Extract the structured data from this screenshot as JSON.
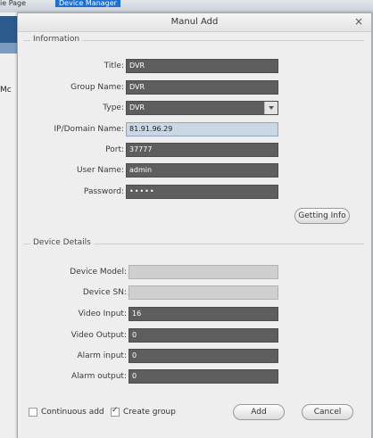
{
  "background": {
    "tab_text": "ie Page",
    "tab_active": "Device Manager",
    "side_label": "Mc"
  },
  "dialog": {
    "title": "Manul Add",
    "close_glyph": "×"
  },
  "information": {
    "section_label": "Information",
    "title_label": "Title:",
    "title_value": "DVR",
    "group_label": "Group Name:",
    "group_value": "DVR",
    "type_label": "Type:",
    "type_value": "DVR",
    "ip_label": "IP/Domain Name:",
    "ip_value": "81.91.96.29",
    "port_label": "Port:",
    "port_value": "37777",
    "user_label": "User Name:",
    "user_value": "admin",
    "password_label": "Password:",
    "password_value": "•••••",
    "getting_info_label": "Getting Info"
  },
  "device_details": {
    "section_label": "Device Details",
    "model_label": "Device Model:",
    "model_value": "",
    "sn_label": "Device SN:",
    "sn_value": "",
    "video_input_label": "Video Input:",
    "video_input_value": "16",
    "video_output_label": "Video Output:",
    "video_output_value": "0",
    "alarm_input_label": "Alarm input:",
    "alarm_input_value": "0",
    "alarm_output_label": "Alarm output:",
    "alarm_output_value": "0"
  },
  "footer": {
    "continuous_add_label": "Continuous add",
    "continuous_add_checked": false,
    "create_group_label": "Create group",
    "create_group_checked": true,
    "add_label": "Add",
    "cancel_label": "Cancel"
  }
}
